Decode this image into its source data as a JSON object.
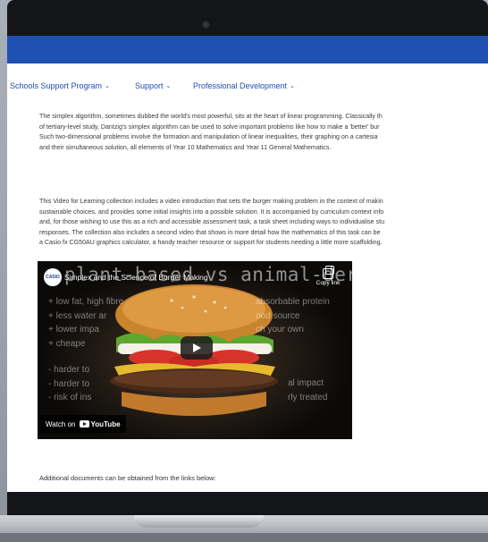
{
  "nav": {
    "items": [
      {
        "label": "Schools Support Program",
        "chevron": "⌄"
      },
      {
        "label": "Support",
        "chevron": "⌄"
      },
      {
        "label": "Professional Development",
        "chevron": "⌄"
      }
    ]
  },
  "content": {
    "paragraph1": [
      "The simplex algorithm, sometimes dubbed the world's most powerful, sits at the heart of linear programming. Classically th",
      "of tertiary-level study, Dantzig's simplex algorithm can be used to solve important problems like how to make a 'better' bur",
      "Such two-dimensional problems involve the formation and manipulation of linear inequalities, their graphing on a cartesia",
      "and their simultaneous solution, all elements of Year 10 Mathematics and Year 11 General Mathematics."
    ],
    "paragraph2": [
      "This Video for Learning collection includes a video introduction that sets the burger making problem in the context of makin",
      "sustainable choices, and provides some initial insights into a possible solution. It is accompanied by curriculum context info",
      "and, for those wishing to use this as a rich and accessible assessment task, a task sheet including ways to individualise stu",
      "responses. The collection also includes a second video that shows in more detail how the mathematics of this task can be",
      "a Casio fx CG50AU graphics calculator, a handy teacher resource or support for students needing a little more scaffolding."
    ],
    "additional_docs": "Additional documents can be obtained from the links below:"
  },
  "video": {
    "channel_logo": "CASIO",
    "title": "Simplex and the Science of Burger Making",
    "overlay_heading": "plant-based vs animal-derived",
    "copy_link_label": "Copy link",
    "bullets_left": [
      "+ low fat, high fibre",
      "+ less water ar",
      "+ lower impa",
      "+ cheape"
    ],
    "bullets_right": [
      "absorbable protein",
      "ood source",
      "ch your own"
    ],
    "bullets_left2": [
      "- harder to",
      "- harder to",
      "- risk of ins"
    ],
    "bullets_right2": [
      "al impact",
      "rly treated"
    ],
    "watch_on_label": "Watch on",
    "youtube_label": "YouTube"
  },
  "colors": {
    "header_blue": "#1f51b3",
    "nav_text": "#1e4fb1",
    "bezel": "#141519"
  }
}
